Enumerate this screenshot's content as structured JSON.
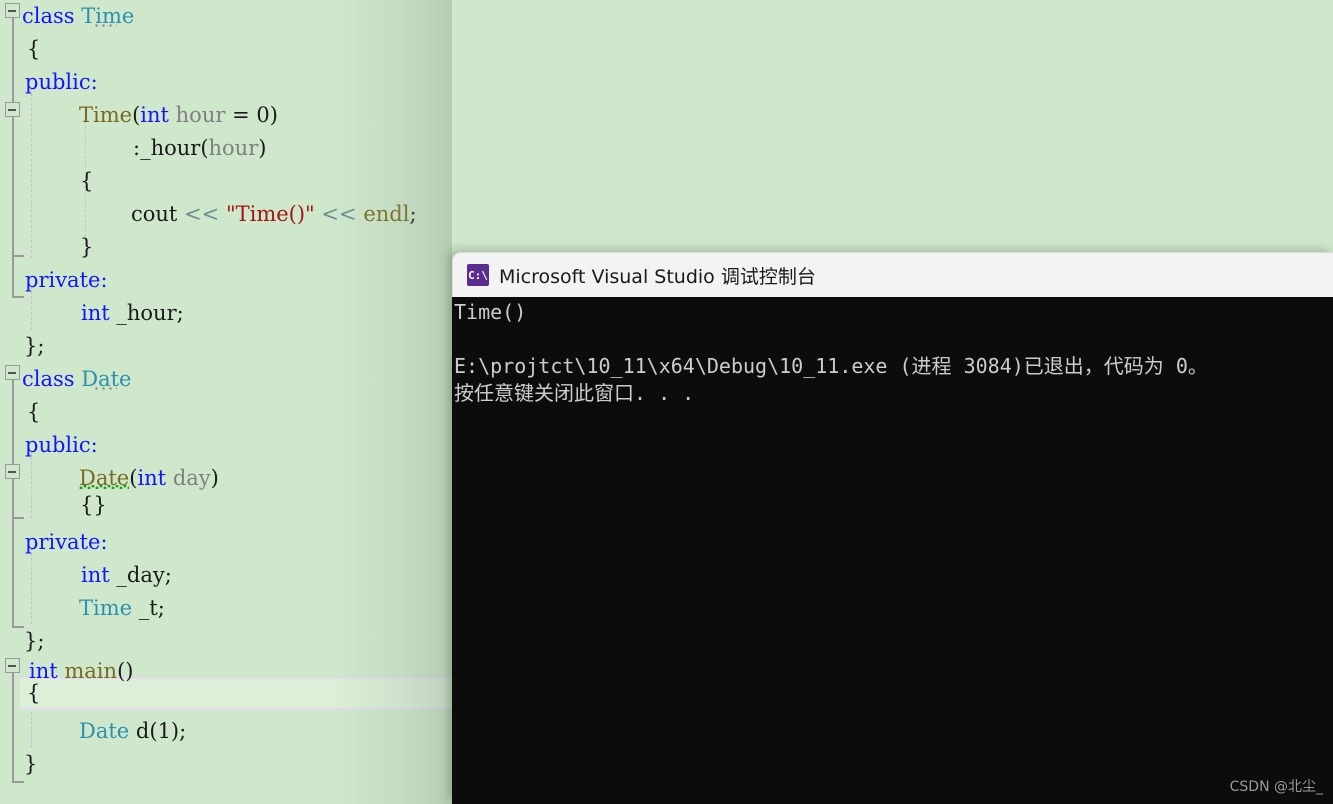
{
  "editor": {
    "background_color": "#cfe8cc",
    "current_line_index": 18,
    "lines": [
      {
        "indent": 0,
        "text": "class Time"
      },
      {
        "indent": 0,
        "text": "{"
      },
      {
        "indent": 0,
        "text": "public:"
      },
      {
        "indent": 1,
        "text": "Time(int hour = 0)"
      },
      {
        "indent": 2,
        "text": ":_hour(hour)"
      },
      {
        "indent": 2,
        "text": "{"
      },
      {
        "indent": 2,
        "text": "cout << \"Time()\" << endl;"
      },
      {
        "indent": 2,
        "text": "}"
      },
      {
        "indent": 0,
        "text": "private:"
      },
      {
        "indent": 1,
        "text": "int _hour;"
      },
      {
        "indent": 0,
        "text": "};"
      },
      {
        "indent": 0,
        "text": "class Date"
      },
      {
        "indent": 0,
        "text": "{"
      },
      {
        "indent": 0,
        "text": "public:"
      },
      {
        "indent": 1,
        "text": "Date(int day)"
      },
      {
        "indent": 1,
        "text": "{}"
      },
      {
        "indent": 0,
        "text": "private:"
      },
      {
        "indent": 1,
        "text": "int _day;"
      },
      {
        "indent": 1,
        "text": "Time _t;"
      },
      {
        "indent": 0,
        "text": "};"
      },
      {
        "indent": 0,
        "text": "int main()"
      },
      {
        "indent": 0,
        "text": "{"
      },
      {
        "indent": 1,
        "text": "Date d(1);"
      },
      {
        "indent": 0,
        "text": "}"
      }
    ],
    "tokens": {
      "line0": {
        "keyword": "class",
        "typename": "Time"
      },
      "line2": {
        "label": "public:"
      },
      "line3": {
        "fn": "Time",
        "punct_open": "(",
        "keyword": "int",
        "param": "hour",
        "eq": " = ",
        "num": "0",
        "punct_close": ")"
      },
      "line4": {
        "colon": ":_hour",
        "punct_open": "(",
        "param": "hour",
        "punct_close": ")"
      },
      "line6": {
        "stream": "cout",
        "op1": "<<",
        "string": "\"Time()\"",
        "op2": "<<",
        "endl": "endl",
        "semi": ";"
      },
      "line8": {
        "label": "private:"
      },
      "line9": {
        "keyword": "int",
        "name": "_hour;"
      },
      "line11": {
        "keyword": "class",
        "typename": "Date"
      },
      "line14": {
        "fn": "Date",
        "punct_open": "(",
        "keyword": "int",
        "param": "day",
        "punct_close": ")",
        "has_error_squiggle": true
      },
      "line17": {
        "keyword": "int",
        "name": "_day;"
      },
      "line18": {
        "typename": "Time",
        "name": "_t;"
      },
      "line20": {
        "keyword": "int",
        "fn": "main",
        "parens": "()"
      },
      "line22": {
        "typename": "Date",
        "name": "d",
        "args": "(1);"
      }
    },
    "colors": {
      "keyword": "#1414ff",
      "typename": "#2b91af",
      "function": "#7a6a20",
      "parameter": "#808080",
      "string": "#a31515",
      "plain": "#1a1a1a",
      "operator": "#6a8f8f",
      "error_squiggle": "#1a9e1a",
      "current_line_fill": "#dcf0d8",
      "current_line_border": "#e2dced",
      "indent_guide": "#cdbfc9",
      "fold_marker": "#9a9a9a"
    }
  },
  "console": {
    "title": "Microsoft Visual Studio 调试控制台",
    "icon": "console-window-icon",
    "icon_glyph": "C:\\",
    "background_color": "#0c0c0c",
    "titlebar_color": "#f3f3f3",
    "text_color": "#cccccc",
    "lines": [
      "Time()",
      "",
      "E:\\projtct\\10_11\\x64\\Debug\\10_11.exe (进程 3084)已退出，代码为 0。",
      "按任意键关闭此窗口. . ."
    ]
  },
  "watermark": {
    "text": "CSDN @北尘_"
  }
}
